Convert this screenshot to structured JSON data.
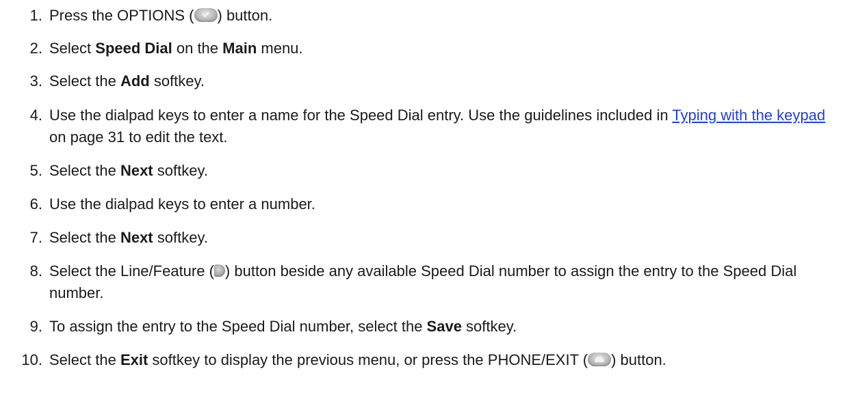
{
  "steps": [
    {
      "num": "1.",
      "segments": [
        {
          "t": "text",
          "v": "Press the OPTIONS ("
        },
        {
          "t": "icon",
          "icon": "options-button-icon"
        },
        {
          "t": "text",
          "v": ") button."
        }
      ]
    },
    {
      "num": "2.",
      "segments": [
        {
          "t": "text",
          "v": "Select "
        },
        {
          "t": "bold",
          "v": "Speed Dial"
        },
        {
          "t": "text",
          "v": " on the "
        },
        {
          "t": "bold",
          "v": "Main"
        },
        {
          "t": "text",
          "v": " menu."
        }
      ]
    },
    {
      "num": "3.",
      "segments": [
        {
          "t": "text",
          "v": "Select the "
        },
        {
          "t": "bold",
          "v": "Add"
        },
        {
          "t": "text",
          "v": " softkey."
        }
      ]
    },
    {
      "num": "4.",
      "segments": [
        {
          "t": "text",
          "v": "Use the dialpad keys to enter a name for the Speed Dial entry. Use the guidelines included in "
        },
        {
          "t": "link",
          "v": "Typing with the keypad"
        },
        {
          "t": "text",
          "v": " on page 31 to edit the text."
        }
      ]
    },
    {
      "num": "5.",
      "segments": [
        {
          "t": "text",
          "v": "Select the "
        },
        {
          "t": "bold",
          "v": "Next"
        },
        {
          "t": "text",
          "v": " softkey."
        }
      ]
    },
    {
      "num": "6.",
      "segments": [
        {
          "t": "text",
          "v": "Use the dialpad keys to enter a number."
        }
      ]
    },
    {
      "num": "7.",
      "segments": [
        {
          "t": "text",
          "v": "Select the "
        },
        {
          "t": "bold",
          "v": "Next"
        },
        {
          "t": "text",
          "v": " softkey."
        }
      ]
    },
    {
      "num": "8.",
      "segments": [
        {
          "t": "text",
          "v": "Select the Line/Feature ("
        },
        {
          "t": "icon",
          "icon": "line-feature-button-icon"
        },
        {
          "t": "text",
          "v": ") button beside any available Speed Dial number to assign the entry to the Speed Dial number."
        }
      ]
    },
    {
      "num": "9.",
      "segments": [
        {
          "t": "text",
          "v": "To assign the entry to the Speed Dial number, select the "
        },
        {
          "t": "bold",
          "v": "Save"
        },
        {
          "t": "text",
          "v": " softkey."
        }
      ]
    },
    {
      "num": "10.",
      "segments": [
        {
          "t": "text",
          "v": "Select the "
        },
        {
          "t": "bold",
          "v": "Exit"
        },
        {
          "t": "text",
          "v": " softkey to display the previous menu, or press the PHONE/EXIT ("
        },
        {
          "t": "icon",
          "icon": "phone-exit-button-icon"
        },
        {
          "t": "text",
          "v": ") button."
        }
      ]
    }
  ],
  "colors": {
    "text": "#1a1a1a",
    "link": "#1f3fe0"
  }
}
